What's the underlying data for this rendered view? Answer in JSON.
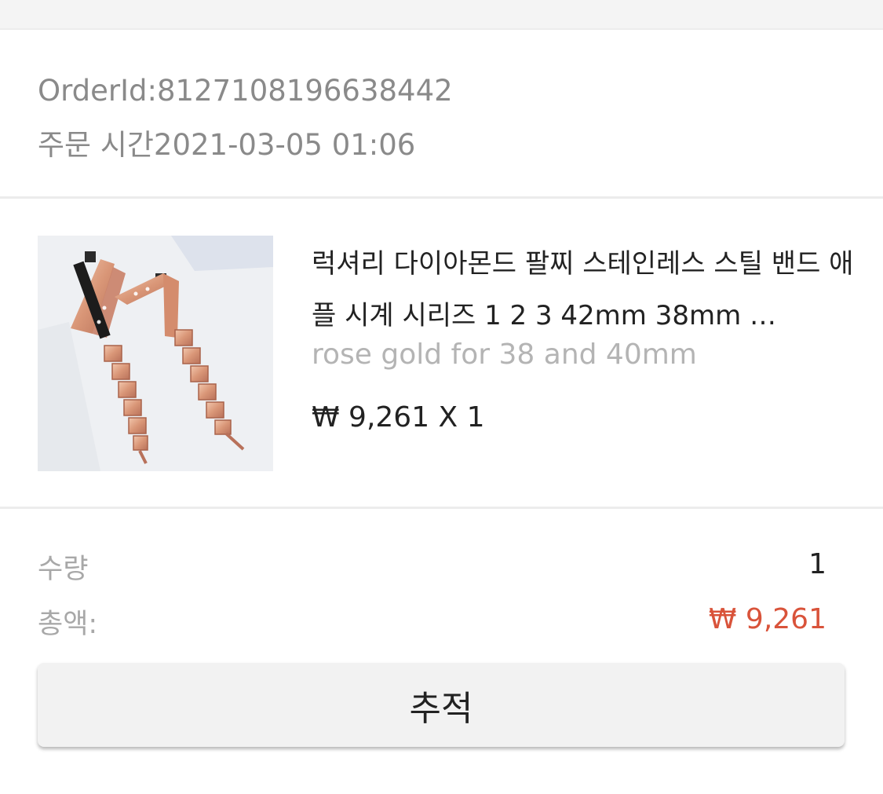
{
  "order": {
    "id_text": "OrderId:8127108196638442",
    "time_text": "주문 시간2021-03-05 01:06"
  },
  "product": {
    "image_icon": "product-thumbnail-watch-band",
    "title": "럭셔리 다이아몬드 팔찌 스테인레스 스틸 밴드 애플 시계 시리즈 1 2 3 42mm 38mm …",
    "variant": "rose gold for 38 and 40mm",
    "price_line": "₩ 9,261 X 1"
  },
  "summary": {
    "quantity_label": "수량",
    "quantity_value": "1",
    "total_label": "총액:",
    "total_value": "₩ 9,261",
    "total_color": "#d9533a"
  },
  "actions": {
    "track_label": "추적"
  }
}
